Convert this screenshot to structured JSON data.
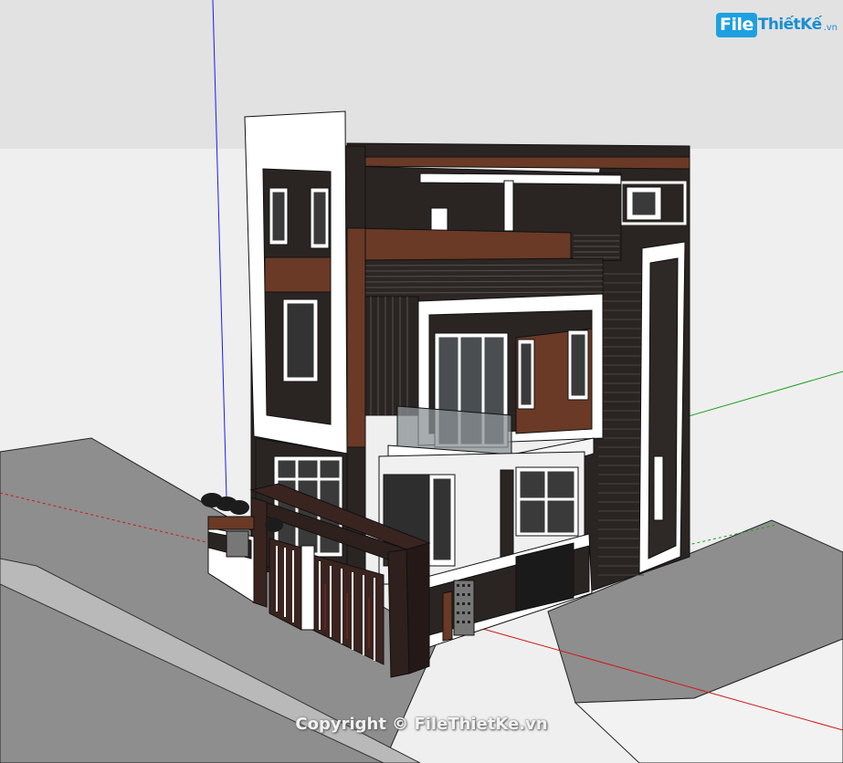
{
  "watermark": {
    "logo_file": "File",
    "logo_rest": "ThiếtKế",
    "logo_tld": ".vn",
    "copyright": "Copyright © FileThietKe.vn"
  },
  "colors": {
    "sky": "#e4e4e4",
    "ground": "#eeeeee",
    "road": "#8d8d8d",
    "dark_wall": "#2a2523",
    "wood": "#6a3a26",
    "white_frame": "#ffffff",
    "glass": "#5a6266",
    "axis_blue": "#1a1aff",
    "axis_green": "#1ea01e",
    "axis_red": "#d01818"
  }
}
